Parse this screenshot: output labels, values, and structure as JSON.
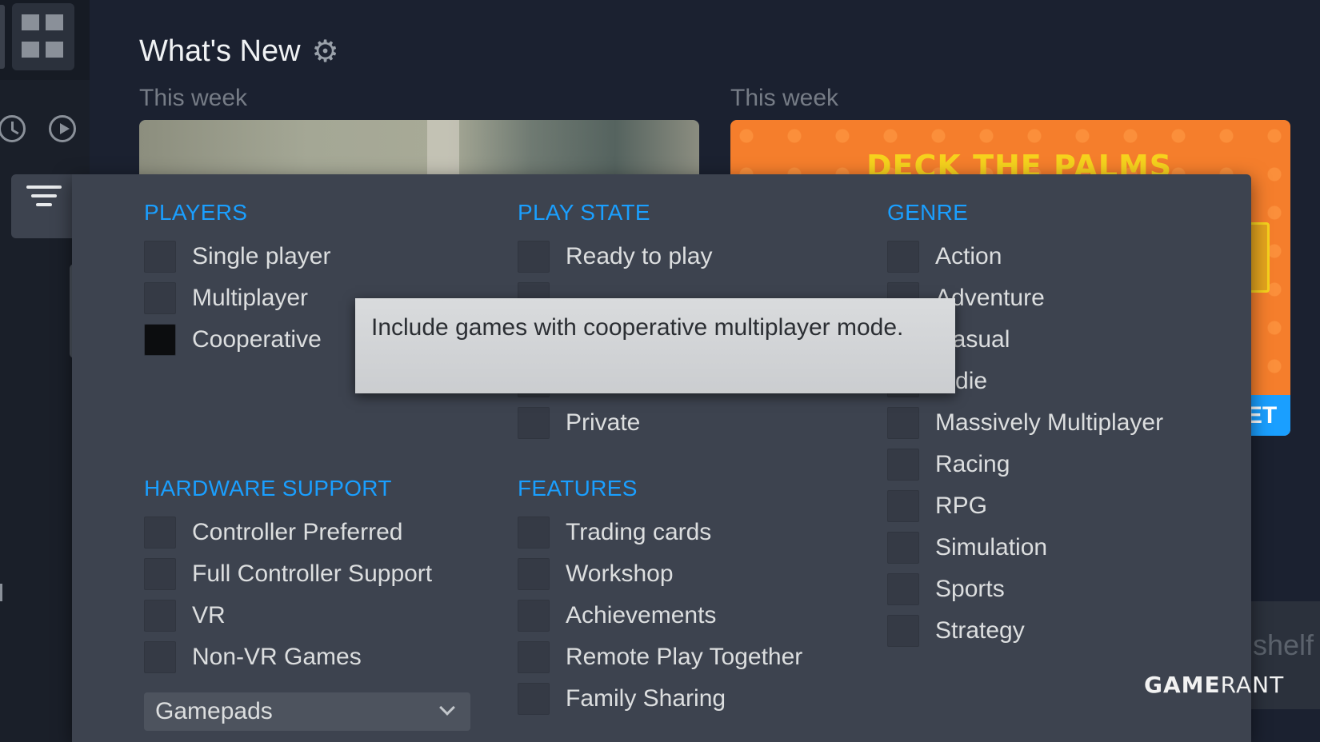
{
  "header": {
    "title": "What's New"
  },
  "week_labels": [
    "This week",
    "This week"
  ],
  "card_right": {
    "title": "DECK THE PALMS",
    "cta": "ET"
  },
  "shelf_text": "shelf",
  "sections": {
    "players": {
      "title": "PLAYERS",
      "options": [
        {
          "label": "Single player",
          "checked": false
        },
        {
          "label": "Multiplayer",
          "checked": false
        },
        {
          "label": "Cooperative",
          "checked": true
        }
      ]
    },
    "play_state": {
      "title": "PLAY STATE",
      "options": [
        {
          "label": "Ready to play",
          "checked": false
        },
        {
          "label": "Private",
          "checked": false
        }
      ]
    },
    "genre": {
      "title": "GENRE",
      "options": [
        {
          "label": "Action",
          "checked": false
        },
        {
          "label": "Adventure",
          "checked": false
        },
        {
          "label": "Casual",
          "checked": false
        },
        {
          "label": "Indie",
          "checked": false
        },
        {
          "label": "Massively Multiplayer",
          "checked": false
        },
        {
          "label": "Racing",
          "checked": false
        },
        {
          "label": "RPG",
          "checked": false
        },
        {
          "label": "Simulation",
          "checked": false
        },
        {
          "label": "Sports",
          "checked": false
        },
        {
          "label": "Strategy",
          "checked": false
        }
      ]
    },
    "hardware": {
      "title": "HARDWARE SUPPORT",
      "options": [
        {
          "label": "Controller Preferred",
          "checked": false
        },
        {
          "label": "Full Controller Support",
          "checked": false
        },
        {
          "label": "VR",
          "checked": false
        },
        {
          "label": "Non-VR Games",
          "checked": false
        }
      ],
      "dropdown": {
        "selected": "Gamepads"
      }
    },
    "features": {
      "title": "FEATURES",
      "options": [
        {
          "label": "Trading cards",
          "checked": false
        },
        {
          "label": "Workshop",
          "checked": false
        },
        {
          "label": "Achievements",
          "checked": false
        },
        {
          "label": "Remote Play Together",
          "checked": false
        },
        {
          "label": "Family Sharing",
          "checked": false
        }
      ]
    }
  },
  "tooltip": {
    "text": "Include games with cooperative multiplayer mode."
  },
  "watermark": {
    "part1": "GAME",
    "part2": "RANT"
  },
  "colors": {
    "accent": "#1a9fff",
    "panel": "#3d434f",
    "background": "#1b2130"
  },
  "icons": [
    "grid-view-icon",
    "clock-icon",
    "play-icon",
    "gear-icon",
    "filter-icon",
    "chevron-down-icon"
  ]
}
